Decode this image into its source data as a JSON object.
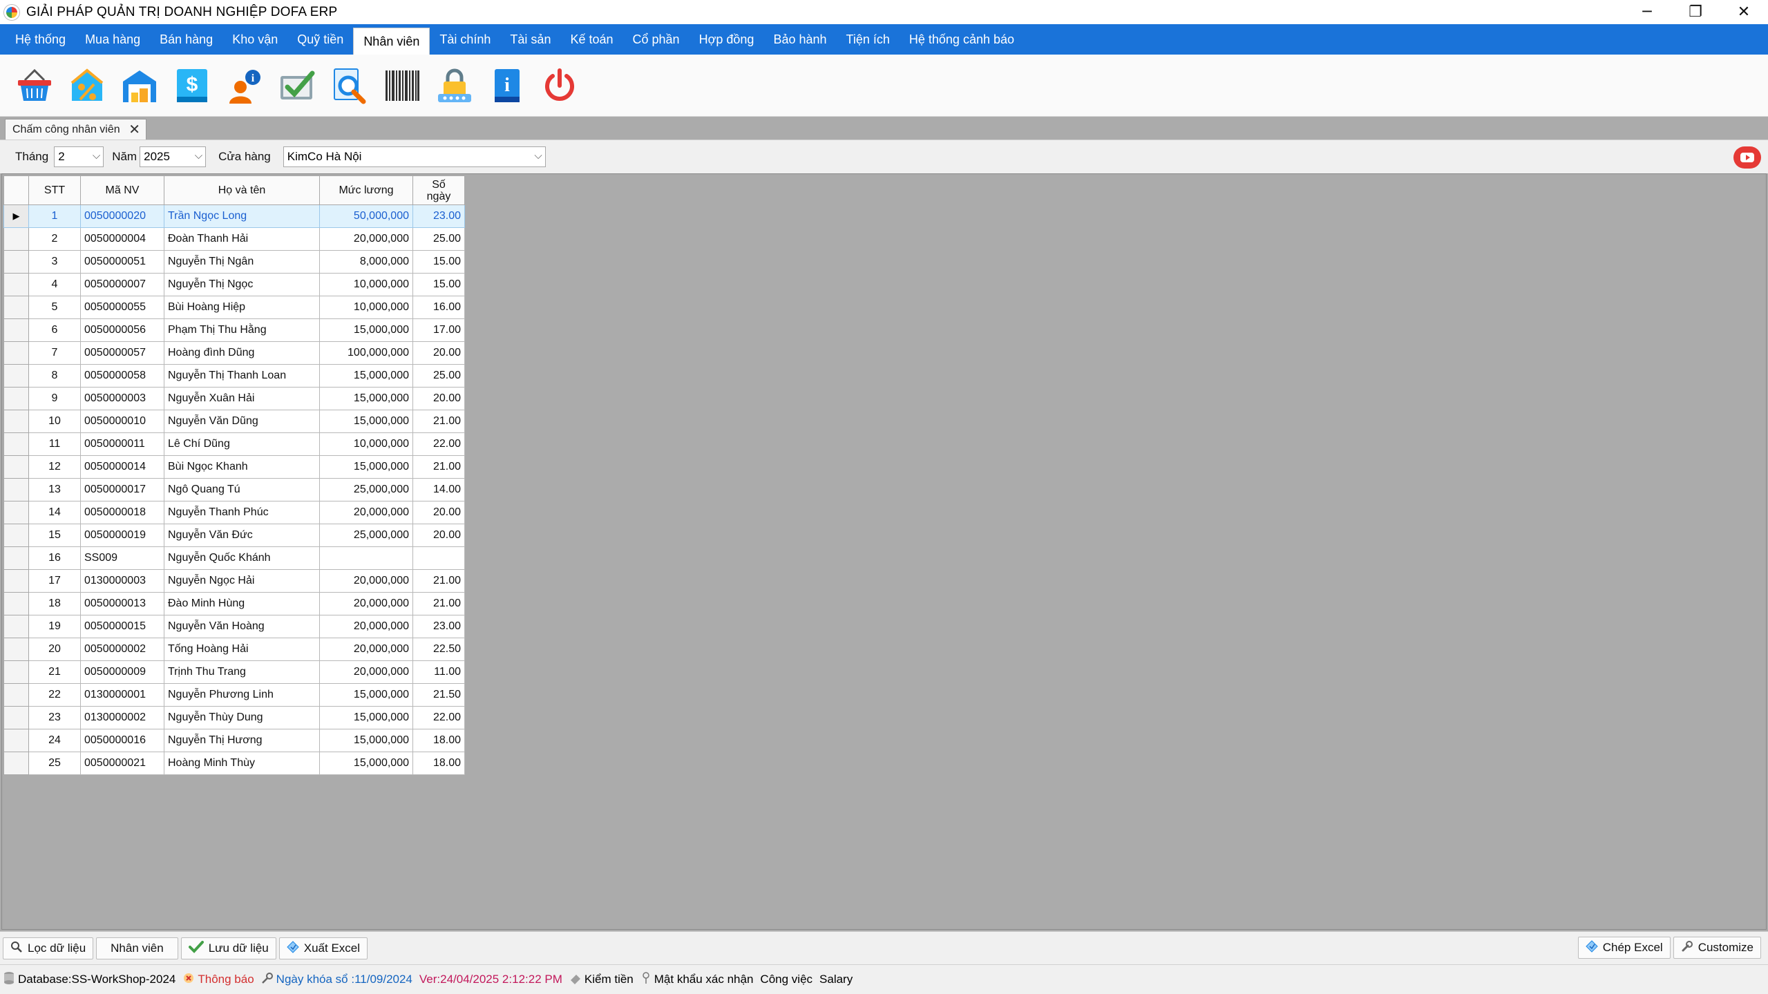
{
  "window": {
    "title": "GIẢI PHÁP QUẢN TRỊ DOANH NGHIỆP DOFA ERP",
    "minimize": "─",
    "restore": "❐",
    "close": "✕"
  },
  "menu": [
    {
      "label": "Hệ thống"
    },
    {
      "label": "Mua hàng"
    },
    {
      "label": "Bán hàng"
    },
    {
      "label": "Kho vận"
    },
    {
      "label": "Quỹ tiền"
    },
    {
      "label": "Nhân viên",
      "active": true
    },
    {
      "label": "Tài chính"
    },
    {
      "label": "Tài sản"
    },
    {
      "label": "Kế toán"
    },
    {
      "label": "Cổ phần"
    },
    {
      "label": "Hợp đồng"
    },
    {
      "label": "Bảo hành"
    },
    {
      "label": "Tiện ích"
    },
    {
      "label": "Hệ thống cảnh báo"
    }
  ],
  "toolbar_icons": [
    "basket-icon",
    "discount-icon",
    "warehouse-icon",
    "dollar-book-icon",
    "user-info-icon",
    "check-board-icon",
    "search-document-icon",
    "barcode-icon",
    "lock-password-icon",
    "info-book-icon",
    "power-icon"
  ],
  "tab": {
    "label": "Chấm công nhân viên",
    "close": "✕"
  },
  "filters": {
    "month_label": "Tháng",
    "month_value": "2",
    "year_label": "Năm",
    "year_value": "2025",
    "store_label": "Cửa hàng",
    "store_value": "KimCo Hà Nội",
    "chevron": "⌵"
  },
  "grid": {
    "headers": {
      "stt": "STT",
      "ma_nv": "Mã NV",
      "ho_ten": "Họ và tên",
      "muc_luong": "Mức lương",
      "so_ngay_1": "Số",
      "so_ngay_2": "ngày"
    },
    "row_indicator": "▶",
    "rows": [
      {
        "stt": "1",
        "ma_nv": "0050000020",
        "ho_ten": "Trần Ngọc Long",
        "muc_luong": "50,000,000",
        "so_ngay": "23.00"
      },
      {
        "stt": "2",
        "ma_nv": "0050000004",
        "ho_ten": "Đoàn Thanh Hải",
        "muc_luong": "20,000,000",
        "so_ngay": "25.00"
      },
      {
        "stt": "3",
        "ma_nv": "0050000051",
        "ho_ten": "Nguyễn Thị Ngân",
        "muc_luong": "8,000,000",
        "so_ngay": "15.00"
      },
      {
        "stt": "4",
        "ma_nv": "0050000007",
        "ho_ten": "Nguyễn Thị Ngọc",
        "muc_luong": "10,000,000",
        "so_ngay": "15.00"
      },
      {
        "stt": "5",
        "ma_nv": "0050000055",
        "ho_ten": "Bùi Hoàng Hiệp",
        "muc_luong": "10,000,000",
        "so_ngay": "16.00"
      },
      {
        "stt": "6",
        "ma_nv": "0050000056",
        "ho_ten": "Phạm Thị Thu Hằng",
        "muc_luong": "15,000,000",
        "so_ngay": "17.00"
      },
      {
        "stt": "7",
        "ma_nv": "0050000057",
        "ho_ten": "Hoàng đình Dũng",
        "muc_luong": "100,000,000",
        "so_ngay": "20.00"
      },
      {
        "stt": "8",
        "ma_nv": "0050000058",
        "ho_ten": "Nguyễn Thị Thanh Loan",
        "muc_luong": "15,000,000",
        "so_ngay": "25.00"
      },
      {
        "stt": "9",
        "ma_nv": "0050000003",
        "ho_ten": "Nguyễn Xuân Hải",
        "muc_luong": "15,000,000",
        "so_ngay": "20.00"
      },
      {
        "stt": "10",
        "ma_nv": "0050000010",
        "ho_ten": "Nguyễn Văn Dũng",
        "muc_luong": "15,000,000",
        "so_ngay": "21.00"
      },
      {
        "stt": "11",
        "ma_nv": "0050000011",
        "ho_ten": "Lê Chí Dũng",
        "muc_luong": "10,000,000",
        "so_ngay": "22.00"
      },
      {
        "stt": "12",
        "ma_nv": "0050000014",
        "ho_ten": "Bùi Ngọc Khanh",
        "muc_luong": "15,000,000",
        "so_ngay": "21.00"
      },
      {
        "stt": "13",
        "ma_nv": "0050000017",
        "ho_ten": "Ngô Quang Tú",
        "muc_luong": "25,000,000",
        "so_ngay": "14.00"
      },
      {
        "stt": "14",
        "ma_nv": "0050000018",
        "ho_ten": "Nguyễn Thanh Phúc",
        "muc_luong": "20,000,000",
        "so_ngay": "20.00"
      },
      {
        "stt": "15",
        "ma_nv": "0050000019",
        "ho_ten": "Nguyễn Văn Đức",
        "muc_luong": "25,000,000",
        "so_ngay": "20.00"
      },
      {
        "stt": "16",
        "ma_nv": "SS009",
        "ho_ten": "Nguyễn Quốc Khánh",
        "muc_luong": "",
        "so_ngay": ""
      },
      {
        "stt": "17",
        "ma_nv": "0130000003",
        "ho_ten": "Nguyễn Ngọc Hải",
        "muc_luong": "20,000,000",
        "so_ngay": "21.00"
      },
      {
        "stt": "18",
        "ma_nv": "0050000013",
        "ho_ten": "Đào Minh Hùng",
        "muc_luong": "20,000,000",
        "so_ngay": "21.00"
      },
      {
        "stt": "19",
        "ma_nv": "0050000015",
        "ho_ten": "Nguyễn Văn Hoàng",
        "muc_luong": "20,000,000",
        "so_ngay": "23.00"
      },
      {
        "stt": "20",
        "ma_nv": "0050000002",
        "ho_ten": "Tống Hoàng Hải",
        "muc_luong": "20,000,000",
        "so_ngay": "22.50"
      },
      {
        "stt": "21",
        "ma_nv": "0050000009",
        "ho_ten": "Trịnh Thu Trang",
        "muc_luong": "20,000,000",
        "so_ngay": "11.00"
      },
      {
        "stt": "22",
        "ma_nv": "0130000001",
        "ho_ten": "Nguyễn Phương Linh",
        "muc_luong": "15,000,000",
        "so_ngay": "21.50"
      },
      {
        "stt": "23",
        "ma_nv": "0130000002",
        "ho_ten": "Nguyễn Thùy Dung",
        "muc_luong": "15,000,000",
        "so_ngay": "22.00"
      },
      {
        "stt": "24",
        "ma_nv": "0050000016",
        "ho_ten": "Nguyễn Thị Hương",
        "muc_luong": "15,000,000",
        "so_ngay": "18.00"
      },
      {
        "stt": "25",
        "ma_nv": "0050000021",
        "ho_ten": "Hoàng Minh Thùy",
        "muc_luong": "15,000,000",
        "so_ngay": "18.00"
      }
    ]
  },
  "bottom_buttons": {
    "filter": "Lọc dữ liệu",
    "employee": "Nhân viên",
    "save": "Lưu dữ liệu",
    "export": "Xuất Excel",
    "copy_excel": "Chép Excel",
    "customize": "Customize"
  },
  "status": {
    "database": "Database:SS-WorkShop-2024",
    "notice": "Thông báo",
    "lock_date": "Ngày khóa sổ :11/09/2024",
    "version": "Ver:24/04/2025 2:12:22 PM",
    "cash_check": "Kiểm tiền",
    "password": "Mật khẩu xác nhận",
    "work": "Công việc",
    "salary": "Salary"
  },
  "colors": {
    "menubar": "#1a73d9",
    "selected_row": "#dff2fd",
    "selected_text": "#1a5fd0",
    "notice": "#d32f2f",
    "lock_date": "#1565c0",
    "version": "#c2185b"
  }
}
